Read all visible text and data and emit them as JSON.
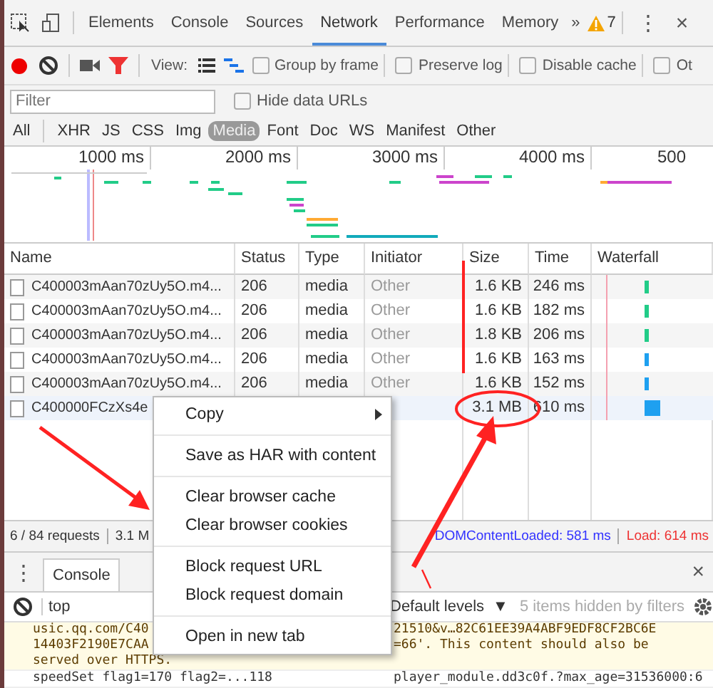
{
  "devtools_tabs": [
    {
      "label": "Elements",
      "selected": false
    },
    {
      "label": "Console",
      "selected": false
    },
    {
      "label": "Sources",
      "selected": false
    },
    {
      "label": "Network",
      "selected": true
    },
    {
      "label": "Performance",
      "selected": false
    },
    {
      "label": "Memory",
      "selected": false
    }
  ],
  "more_tabs": "»",
  "warning_count": "7",
  "menu_glyph": "⋮",
  "close_glyph": "×",
  "toolbar": {
    "recording": true,
    "filter_active": true,
    "view_label": "View:",
    "checkboxes": [
      {
        "label": "Group by frame",
        "checked": false
      },
      {
        "label": "Preserve log",
        "checked": false
      },
      {
        "label": "Disable cache",
        "checked": false
      },
      {
        "label": "Ot",
        "checked": false
      }
    ]
  },
  "filter": {
    "placeholder": "Filter",
    "hide_data_urls": {
      "label": "Hide data URLs",
      "checked": false
    }
  },
  "type_filters": [
    {
      "label": "All",
      "selected": false
    },
    {
      "label": "XHR",
      "selected": false
    },
    {
      "label": "JS",
      "selected": false
    },
    {
      "label": "CSS",
      "selected": false
    },
    {
      "label": "Img",
      "selected": false
    },
    {
      "label": "Media",
      "selected": true
    },
    {
      "label": "Font",
      "selected": false
    },
    {
      "label": "Doc",
      "selected": false
    },
    {
      "label": "WS",
      "selected": false
    },
    {
      "label": "Manifest",
      "selected": false
    },
    {
      "label": "Other",
      "selected": false
    }
  ],
  "overview": {
    "ticks": [
      "1000 ms",
      "2000 ms",
      "3000 ms",
      "4000 ms",
      "500"
    ]
  },
  "table": {
    "columns": [
      "Name",
      "Status",
      "Type",
      "Initiator",
      "Size",
      "Time",
      "Waterfall"
    ],
    "rows": [
      {
        "name": "C400003mAan70zUy5O.m4...",
        "status": "206",
        "type": "media",
        "initiator": "Other",
        "size": "1.6 KB",
        "time": "246 ms",
        "selected": false
      },
      {
        "name": "C400003mAan70zUy5O.m4...",
        "status": "206",
        "type": "media",
        "initiator": "Other",
        "size": "1.6 KB",
        "time": "182 ms",
        "selected": false
      },
      {
        "name": "C400003mAan70zUy5O.m4...",
        "status": "206",
        "type": "media",
        "initiator": "Other",
        "size": "1.8 KB",
        "time": "206 ms",
        "selected": false
      },
      {
        "name": "C400003mAan70zUy5O.m4...",
        "status": "206",
        "type": "media",
        "initiator": "Other",
        "size": "1.6 KB",
        "time": "163 ms",
        "selected": false
      },
      {
        "name": "C400003mAan70zUy5O.m4...",
        "status": "206",
        "type": "media",
        "initiator": "Other",
        "size": "1.6 KB",
        "time": "152 ms",
        "selected": false
      },
      {
        "name": "C400000FCzXs4e",
        "size": "3.1 MB",
        "time": "610 ms",
        "selected": true
      }
    ]
  },
  "context_menu": [
    {
      "kind": "submenu",
      "label": "Copy"
    },
    {
      "kind": "separator"
    },
    {
      "kind": "item",
      "label": "Save as HAR with content"
    },
    {
      "kind": "separator"
    },
    {
      "kind": "item",
      "label": "Clear browser cache"
    },
    {
      "kind": "item",
      "label": "Clear browser cookies"
    },
    {
      "kind": "separator"
    },
    {
      "kind": "item",
      "label": "Block request URL"
    },
    {
      "kind": "item",
      "label": "Block request domain"
    },
    {
      "kind": "separator"
    },
    {
      "kind": "item",
      "label": "Open in new tab"
    }
  ],
  "status_bar": {
    "requests": "6 / 84 requests",
    "transferred": "3.1 M",
    "dom_content_loaded": "DOMContentLoaded: 581 ms",
    "load": "Load: 614 ms"
  },
  "drawer": {
    "tabs": [
      {
        "label": "Console",
        "selected": true
      }
    ],
    "context": "top",
    "levels": "Default levels",
    "levels_arrow": "▼",
    "hidden": "5 items hidden by filters",
    "messages": [
      {
        "kind": "warning",
        "lines": [
          {
            "left": "usic.qq.com/C40",
            "right": "21510&v…82C61EE39A4ABF9EDF8CF2BC6E"
          },
          {
            "left": "14403F2190E7CAA",
            "right": "=66'. This content should also be"
          },
          {
            "left": "served over HTTPS."
          }
        ]
      },
      {
        "kind": "log",
        "lines": [
          {
            "left": "speedSet flag1=170 flag2=...118",
            "right": "player_module.dd3c0f.?max_age=31536000:6"
          }
        ]
      }
    ]
  }
}
